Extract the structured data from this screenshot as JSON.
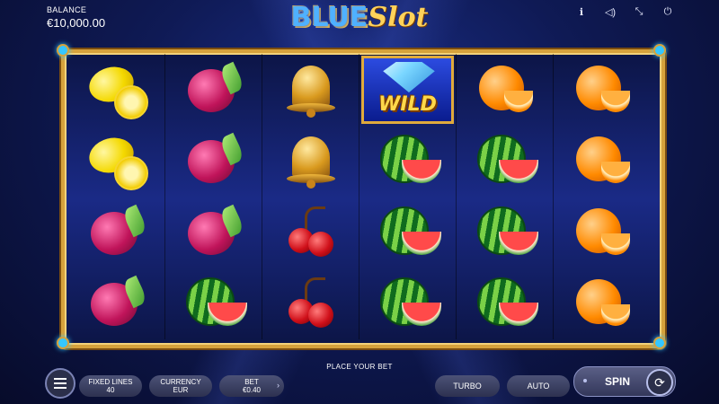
{
  "header": {
    "balance_label": "BALANCE",
    "balance_value": "€10,000.00",
    "logo_part1": "BLUE",
    "logo_part2": "Slot",
    "icons": [
      "info-icon",
      "sound-icon",
      "fullscreen-icon",
      "power-icon"
    ]
  },
  "reels": [
    [
      "lemon",
      "lemon",
      "plum",
      "plum"
    ],
    [
      "plum",
      "plum",
      "plum",
      "watermelon"
    ],
    [
      "bell",
      "bell",
      "cherry",
      "cherry"
    ],
    [
      "wild",
      "watermelon",
      "watermelon",
      "watermelon"
    ],
    [
      "orange",
      "watermelon",
      "watermelon",
      "watermelon"
    ],
    [
      "orange",
      "orange",
      "orange",
      "orange"
    ]
  ],
  "wild_label": "WILD",
  "footer": {
    "place_bet": "PLACE YOUR BET",
    "fixed_lines_label": "FIXED LINES",
    "fixed_lines_value": "40",
    "currency_label": "CURRENCY",
    "currency_value": "EUR",
    "bet_label": "BET",
    "bet_value": "€0.40",
    "turbo_label": "TURBO",
    "auto_label": "AUTO",
    "spin_label": "SPIN"
  },
  "colors": {
    "frame_gold": "#d6a23c",
    "background_blue": "#1b2f8a",
    "gem_blue": "#35c7ff"
  }
}
